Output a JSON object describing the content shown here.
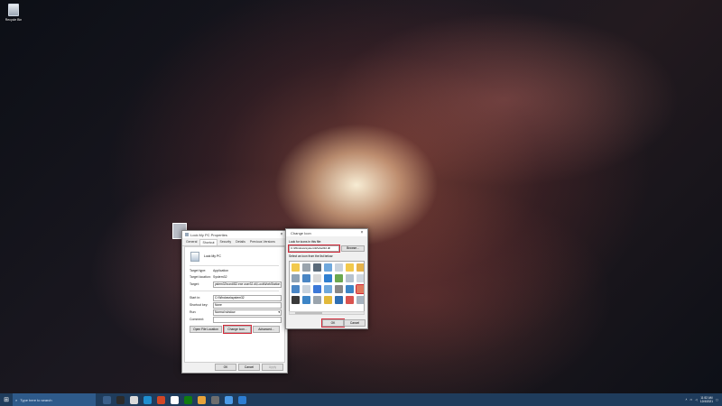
{
  "desktop": {
    "recycle_bin_label": "Recycle Bin"
  },
  "properties": {
    "title": "Lock My PC Properties",
    "tabs": [
      "General",
      "Shortcut",
      "Security",
      "Details",
      "Previous Versions"
    ],
    "shortcut_name": "Lock My PC",
    "target_type_label": "Target type:",
    "target_type_value": "Application",
    "target_location_label": "Target location:",
    "target_location_value": "System32",
    "target_label": "Target:",
    "target_value": "ystem32\\rundll32.exe user32.dll,LockWorkStation",
    "start_in_label": "Start in:",
    "start_in_value": "C:\\Windows\\system32",
    "shortcut_key_label": "Shortcut key:",
    "shortcut_key_value": "None",
    "run_label": "Run:",
    "run_value": "Normal window",
    "comment_label": "Comment:",
    "comment_value": "",
    "open_location_button": "Open File Location",
    "change_icon_button": "Change Icon...",
    "advanced_button": "Advanced...",
    "ok_button": "OK",
    "cancel_button": "Cancel",
    "apply_button": "Apply"
  },
  "change_icon": {
    "title": "Change Icon",
    "look_label": "Look for icons in this file:",
    "path_value": "C:\\Windows\\system32\\shell32.dll",
    "browse_button": "Browse...",
    "select_label": "Select an icon from the list below:",
    "ok_button": "OK",
    "cancel_button": "Cancel",
    "icon_colors": [
      "#f2c94c",
      "#9aa4ad",
      "#5b6b7a",
      "#6fa8dc",
      "#c9d3dd",
      "#f2c94c",
      "#e6b34a",
      "#8fa3b5",
      "#4a86c5",
      "#d9d9d9",
      "#2f7fd0",
      "#6aa84f",
      "#b6c2ce",
      "#d0d8e0",
      "#4a86c5",
      "#c9d3dd",
      "#3c78d8",
      "#6fa8dc",
      "#888888",
      "#3d85c6",
      "#e07a5f",
      "#3a3a3a",
      "#3d85c6",
      "#9aa4ad",
      "#e2b93b",
      "#2f6fb3",
      "#d9534f",
      "#a7b3bf"
    ]
  },
  "taskbar": {
    "search_placeholder": "Type here to search",
    "time": "11:52 AM",
    "date": "12/4/2021"
  }
}
